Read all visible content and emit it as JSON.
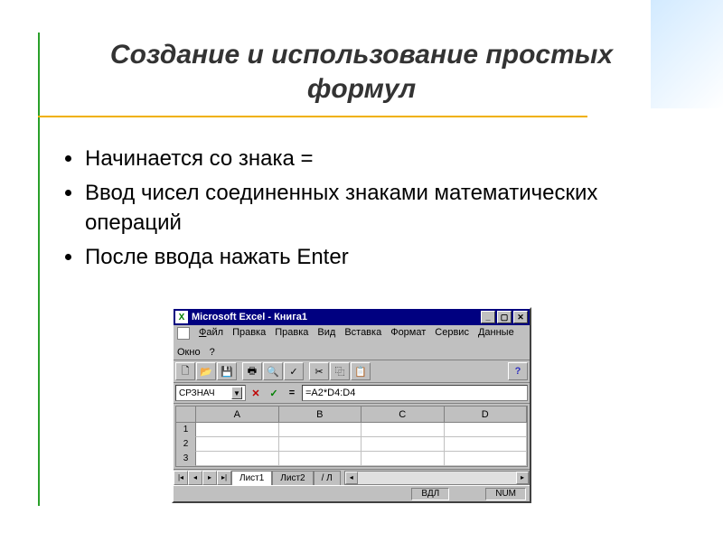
{
  "slide": {
    "title": "Создание и использование простых формул",
    "bullets": [
      "Начинается со знака =",
      "Ввод чисел соединенных знаками математических операций",
      "После ввода нажать Enter"
    ]
  },
  "excel": {
    "title": "Microsoft Excel - Книга1",
    "menus": {
      "file": "Файл",
      "edit1": "Правка",
      "edit2": "Правка",
      "view": "Вид",
      "insert": "Вставка",
      "format": "Формат",
      "tools": "Сервис",
      "data": "Данные",
      "window": "Окно",
      "help": "?"
    },
    "toolbar_icons": {
      "new": "🗋",
      "open": "📂",
      "save": "💾",
      "print": "🖶",
      "preview": "🔍",
      "spell": "✓",
      "cut": "✂",
      "copy": "⿻",
      "paste": "📋",
      "help": "?"
    },
    "namebox": "СРЗНАЧ",
    "formula": "=A2*D4:D4",
    "fx": {
      "cancel": "✕",
      "ok": "✓",
      "eq": "="
    },
    "columns": [
      "A",
      "B",
      "C",
      "D"
    ],
    "rows": [
      "1",
      "2",
      "3"
    ],
    "tabs": {
      "active": "Лист1",
      "other": "Лист2",
      "cut": "/ Л"
    },
    "nav": {
      "first": "|◂",
      "prev": "◂",
      "next": "▸",
      "last": "▸|"
    },
    "status": {
      "mode": "ВДЛ",
      "num": "NUM"
    }
  }
}
